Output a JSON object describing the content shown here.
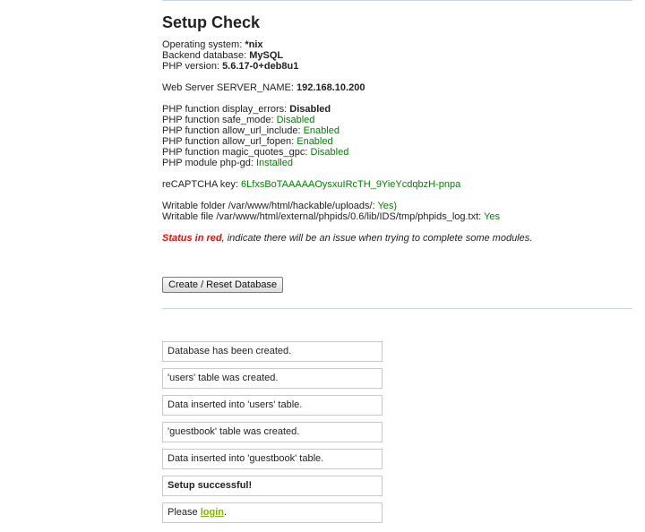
{
  "page": {
    "title": "Setup Check"
  },
  "system": {
    "os_label": "Operating system: ",
    "os_value": "*nix",
    "db_label": "Backend database: ",
    "db_value": "MySQL",
    "php_label": "PHP version: ",
    "php_value": "5.6.17-0+deb8u1"
  },
  "server": {
    "label": "Web Server SERVER_NAME: ",
    "value": "192.168.10.200"
  },
  "php_functions": [
    {
      "label": "PHP function display_errors: ",
      "value": "Disabled",
      "style": "bold"
    },
    {
      "label": "PHP function safe_mode: ",
      "value": "Disabled",
      "style": "green"
    },
    {
      "label": "PHP function allow_url_include: ",
      "value": "Enabled",
      "style": "green"
    },
    {
      "label": "PHP function allow_url_fopen: ",
      "value": "Enabled",
      "style": "green"
    },
    {
      "label": "PHP function magic_quotes_gpc: ",
      "value": "Disabled",
      "style": "green"
    },
    {
      "label": "PHP module php-gd: ",
      "value": "Installed",
      "style": "green"
    }
  ],
  "recaptcha": {
    "label": "reCAPTCHA key: ",
    "value": "6LfxsBoTAAAAAOysxuIRcTH_9YieYcdqbzH-pnpa"
  },
  "writable": {
    "folder_label": "Writable folder /var/www/html/hackable/uploads/: ",
    "folder_value": "Yes)",
    "file_label": "Writable file /var/www/html/external/phpids/0.6/lib/IDS/tmp/phpids_log.txt: ",
    "file_value": "Yes"
  },
  "status_note": {
    "strong": "Status in red",
    "rest": ", indicate there will be an issue when trying to complete some modules."
  },
  "button": {
    "label": "Create / Reset Database"
  },
  "messages": {
    "db_created": "Database has been created.",
    "users_created": "'users' table was created.",
    "users_inserted": "Data inserted into 'users' table.",
    "guestbook_created": "'guestbook' table was created.",
    "guestbook_inserted": "Data inserted into 'guestbook' table.",
    "success": "Setup successful!",
    "login_prefix": "Please ",
    "login_link": "login",
    "login_suffix": "."
  },
  "colors": {
    "ok": "#008000",
    "error": "#ff0000",
    "link": "#7fb800",
    "rule": "#c9d6e3"
  }
}
